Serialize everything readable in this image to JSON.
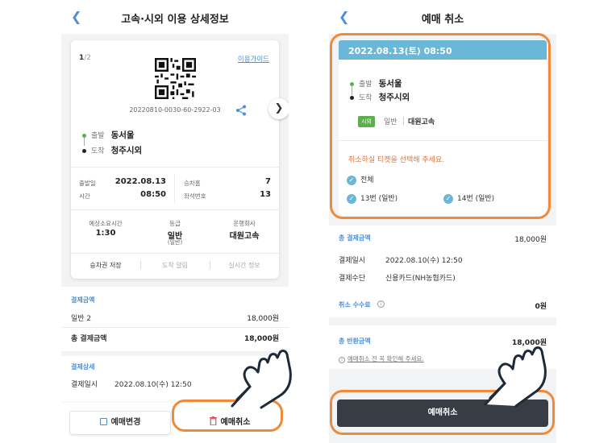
{
  "colors": {
    "accent": "#4d8fd6",
    "highlight": "#f08a3a",
    "header_band": "#6bb7d7",
    "dark_button": "#383c44",
    "badge_green": "#5cae4f",
    "notice_orange": "#e0743b"
  },
  "left": {
    "title": "고속·시외 이용 상세정보",
    "back_icon": "chevron-left",
    "pager_current": "1",
    "pager_total": "/2",
    "guide_link": "이용가이드",
    "ticket_number": "20220810-0030-60-2922-03",
    "departure_label": "출발",
    "departure": "동서울",
    "arrival_label": "도착",
    "arrival": "청주시외",
    "date_label": "출발일",
    "date": "2022.08.13",
    "time_label": "시간",
    "time": "08:50",
    "platform_label": "승차홈",
    "platform": "7",
    "seat_label": "좌석번호",
    "seat": "13",
    "duration_label": "예상소요시간",
    "duration": "1:30",
    "grade_label": "등급",
    "grade": "일반",
    "grade_sub": "(일반)",
    "company_label": "운행회사",
    "company": "대원고속",
    "actions": [
      "승차권 저장",
      "도착 알림",
      "실시간 정보"
    ],
    "payment_title": "결제금액",
    "payment_item_label": "일반 2",
    "payment_item_value": "18,000원",
    "payment_total_label": "총 결제금액",
    "payment_total_value": "18,000원",
    "detail_title": "결제상세",
    "detail_date_label": "결제일시",
    "detail_date_value": "2022.08.10(수) 12:50",
    "btn_change": "예매변경",
    "btn_cancel": "예매취소"
  },
  "right": {
    "title": "예매 취소",
    "back_icon": "chevron-left",
    "header_datetime": "2022.08.13(토) 08:50",
    "departure_label": "출발",
    "departure": "동서울",
    "arrival_label": "도착",
    "arrival": "청주시외",
    "badge": "시외",
    "grade": "일반",
    "company": "대원고속",
    "notice": "취소하실 티켓을 선택해 주세요.",
    "check_all": "전체",
    "check_seat1": "13번 (일반)",
    "check_seat2": "14번 (일반)",
    "total_pay_label": "총 결제금액",
    "total_pay_value": "18,000원",
    "pay_date_label": "결제일시",
    "pay_date_value": "2022.08.10(수) 12:50",
    "pay_method_label": "결제수단",
    "pay_method_value": "신용카드(NH농협카드)",
    "fee_label": "취소 수수료",
    "fee_value": "0원",
    "refund_label": "총 반환금액",
    "refund_value": "18,000원",
    "refund_note": "예매취소 전 꼭 확인해 주세요.",
    "cancel_button": "예매취소"
  }
}
